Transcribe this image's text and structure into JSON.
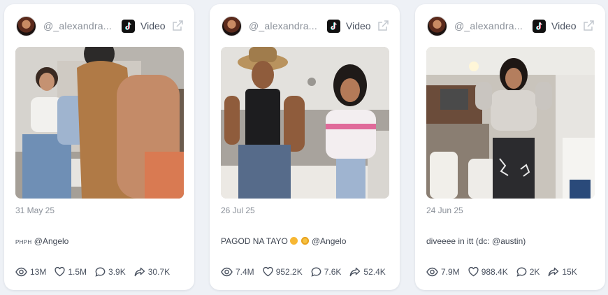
{
  "posts": [
    {
      "username": "@_alexandra...",
      "type_label": "Video",
      "date": "31 May 25",
      "caption_prefix": "PHPH",
      "caption": "@Angelo",
      "stats": {
        "views": "13M",
        "likes": "1.5M",
        "comments": "3.9K",
        "shares": "30.7K"
      }
    },
    {
      "username": "@_alexandra...",
      "type_label": "Video",
      "date": "26 Jul 25",
      "caption": "PAGOD NA TAYO",
      "caption_mention": "@Angelo",
      "stats": {
        "views": "7.4M",
        "likes": "952.2K",
        "comments": "7.6K",
        "shares": "52.4K"
      }
    },
    {
      "username": "@_alexandra...",
      "type_label": "Video",
      "date": "24 Jun 25",
      "caption": "diveeee in itt (dc: @austin)",
      "stats": {
        "views": "7.9M",
        "likes": "988.4K",
        "comments": "2K",
        "shares": "15K"
      }
    }
  ],
  "icons": {
    "platform": "tiktok-icon",
    "open": "external-link-icon",
    "views": "eye-icon",
    "likes": "heart-icon",
    "comments": "comment-icon",
    "shares": "share-icon"
  },
  "colors": {
    "background": "#eef1f6",
    "card": "#ffffff",
    "muted_text": "#8a9099",
    "body_text": "#4a5260"
  }
}
